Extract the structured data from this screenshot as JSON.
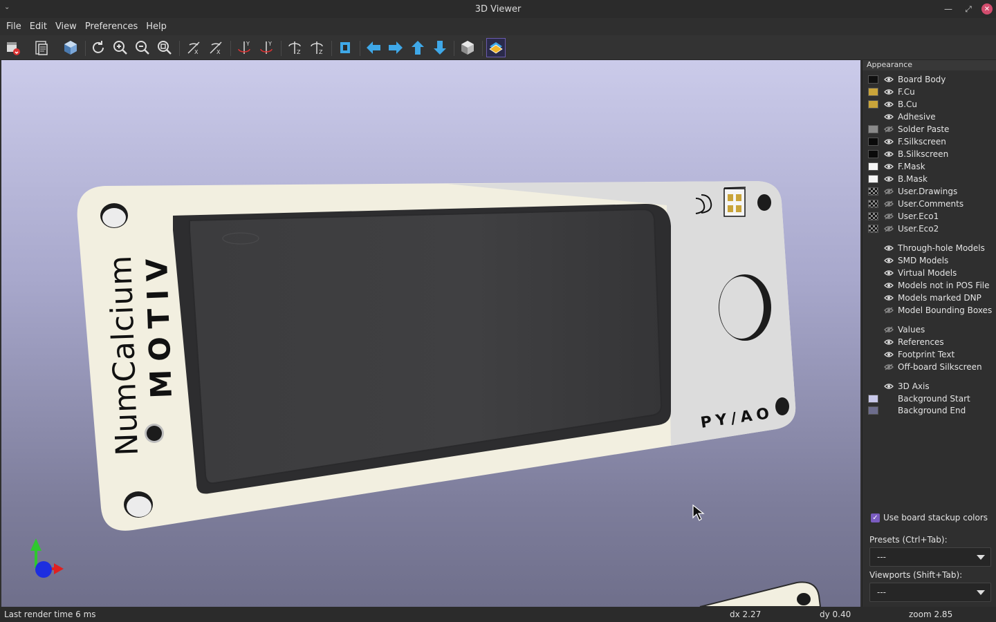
{
  "window": {
    "title": "3D Viewer"
  },
  "menubar": {
    "items": [
      "File",
      "Edit",
      "View",
      "Preferences",
      "Help"
    ]
  },
  "toolbar": {
    "buttons": [
      "render-options",
      "copy-to-clipboard",
      "raytracing",
      "reload",
      "zoom-in",
      "zoom-out",
      "zoom-fit",
      "rotate-x-cw",
      "rotate-x-ccw",
      "rotate-y-cw",
      "rotate-y-ccw",
      "rotate-z-cw",
      "rotate-z-ccw",
      "flip-board",
      "move-left",
      "move-right",
      "move-up",
      "move-down",
      "orthographic",
      "layers-manager"
    ],
    "active_button": "layers-manager",
    "arrow_color": "#3fa8e8"
  },
  "board": {
    "silkscreen_left_1": "NumCalcium",
    "silkscreen_left_2": "MOTIV",
    "silkscreen_right": "PY/AO",
    "mask_color": "#f2efe0",
    "display_color": "#3a3a3c"
  },
  "appearance": {
    "header": "Appearance",
    "layers": [
      {
        "label": "Board Body",
        "swatch": "#101010",
        "eye": "visible"
      },
      {
        "label": "F.Cu",
        "swatch": "#c9a43a",
        "eye": "visible"
      },
      {
        "label": "B.Cu",
        "swatch": "#c9a43a",
        "eye": "visible"
      },
      {
        "label": "Adhesive",
        "swatch": "",
        "eye": "visible"
      },
      {
        "label": "Solder Paste",
        "swatch": "#8a8a8a",
        "eye": "hidden"
      },
      {
        "label": "F.Silkscreen",
        "swatch": "#0a0a0a",
        "eye": "visible"
      },
      {
        "label": "B.Silkscreen",
        "swatch": "#0a0a0a",
        "eye": "visible"
      },
      {
        "label": "F.Mask",
        "swatch": "#f5f5f5",
        "eye": "visible"
      },
      {
        "label": "B.Mask",
        "swatch": "#f5f5f5",
        "eye": "visible"
      },
      {
        "label": "User.Drawings",
        "swatch": "checker",
        "eye": "hidden"
      },
      {
        "label": "User.Comments",
        "swatch": "checker",
        "eye": "hidden"
      },
      {
        "label": "User.Eco1",
        "swatch": "checker",
        "eye": "hidden"
      },
      {
        "label": "User.Eco2",
        "swatch": "checker",
        "eye": "hidden"
      }
    ],
    "models": [
      {
        "label": "Through-hole Models",
        "eye": "visible"
      },
      {
        "label": "SMD Models",
        "eye": "visible"
      },
      {
        "label": "Virtual Models",
        "eye": "visible"
      },
      {
        "label": "Models not in POS File",
        "eye": "visible"
      },
      {
        "label": "Models marked DNP",
        "eye": "visible"
      },
      {
        "label": "Model Bounding Boxes",
        "eye": "hidden"
      }
    ],
    "text": [
      {
        "label": "Values",
        "eye": "hidden"
      },
      {
        "label": "References",
        "eye": "visible"
      },
      {
        "label": "Footprint Text",
        "eye": "visible"
      },
      {
        "label": "Off-board Silkscreen",
        "eye": "hidden"
      }
    ],
    "other": [
      {
        "label": "3D Axis",
        "swatch": "",
        "eye": "visible"
      },
      {
        "label": "Background Start",
        "swatch": "#c9c9ea",
        "eye": "none"
      },
      {
        "label": "Background End",
        "swatch": "#6d6d8c",
        "eye": "none"
      }
    ],
    "use_stackup_colors_label": "Use board stackup colors",
    "use_stackup_colors_checked": true,
    "presets_label": "Presets (Ctrl+Tab):",
    "presets_value": "---",
    "viewports_label": "Viewports (Shift+Tab):",
    "viewports_value": "---"
  },
  "status": {
    "render_time": "Last render time 6 ms",
    "dx": "dx 2.27",
    "dy": "dy 0.40",
    "zoom": "zoom 2.85"
  }
}
